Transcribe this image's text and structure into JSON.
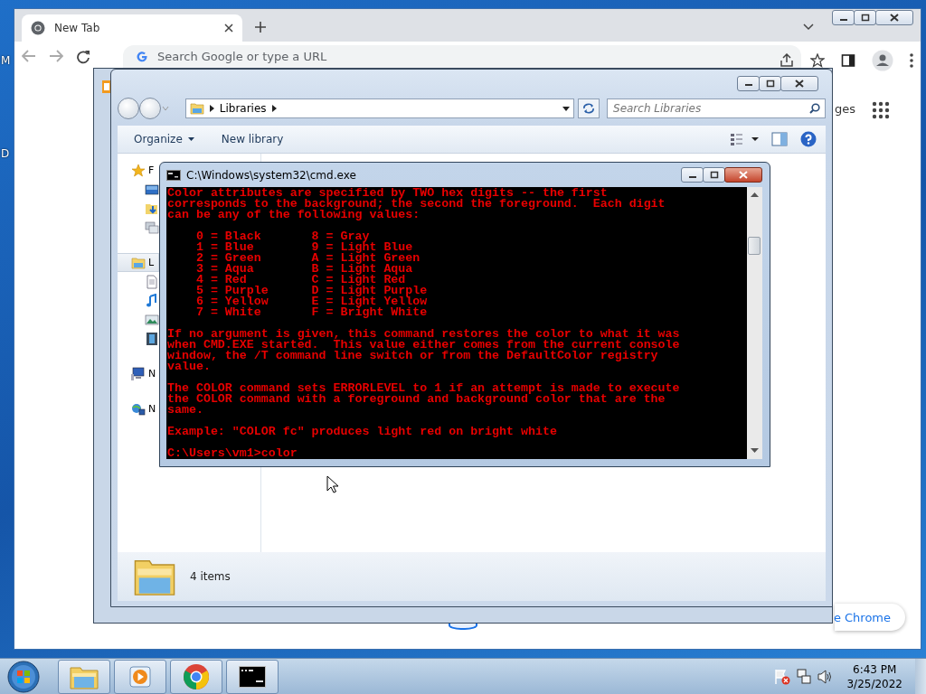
{
  "desktop": {
    "edge_labels": [
      "M",
      "D"
    ]
  },
  "browser": {
    "tabs": [
      {
        "title": "New Tab",
        "selected": true
      }
    ],
    "omnibox": {
      "placeholder": "Search Google or type a URL"
    },
    "shortcut_fragment": "ges",
    "customize_fragment": "e Chrome"
  },
  "explorer": {
    "address": [
      "Libraries"
    ],
    "search": {
      "placeholder": "Search Libraries"
    },
    "toolbar": [
      "Organize",
      "New library"
    ],
    "nav_items": [
      {
        "label": "F",
        "kind": "star",
        "selected": false,
        "children": [
          {
            "kind": "desktop"
          },
          {
            "kind": "downloads"
          },
          {
            "kind": "places"
          }
        ]
      },
      {
        "label": "L",
        "kind": "library",
        "selected": true,
        "children": [
          {
            "kind": "document"
          },
          {
            "kind": "music"
          },
          {
            "kind": "pictures"
          },
          {
            "kind": "video"
          }
        ]
      },
      {
        "label": "N",
        "kind": "computer",
        "selected": false
      },
      {
        "label": "N",
        "kind": "network",
        "selected": false
      }
    ],
    "status": "4 items"
  },
  "console": {
    "title": "C:\\Windows\\system32\\cmd.exe",
    "blocks": [
      [
        "Color attributes are specified by TWO hex digits -- the first",
        "corresponds to the background; the second the foreground.  Each digit",
        "can be any of the following values:"
      ],
      [
        "    0 = Black       8 = Gray",
        "    1 = Blue        9 = Light Blue",
        "    2 = Green       A = Light Green",
        "    3 = Aqua        B = Light Aqua",
        "    4 = Red         C = Light Red",
        "    5 = Purple      D = Light Purple",
        "    6 = Yellow      E = Light Yellow",
        "    7 = White       F = Bright White"
      ],
      [
        "If no argument is given, this command restores the color to what it was",
        "when CMD.EXE started.  This value either comes from the current console",
        "window, the /T command line switch or from the DefaultColor registry",
        "value."
      ],
      [
        "The COLOR command sets ERRORLEVEL to 1 if an attempt is made to execute",
        "the COLOR command with a foreground and background color that are the",
        "same."
      ],
      [
        "Example: \"COLOR fc\" produces light red on bright white"
      ],
      [
        "C:\\Users\\vm1>color"
      ]
    ]
  },
  "taskbar": {
    "buttons": [
      {
        "kind": "explorer"
      },
      {
        "kind": "media"
      },
      {
        "kind": "chrome"
      },
      {
        "kind": "console"
      }
    ],
    "clock": {
      "time": "6:43 PM",
      "date": "3/25/2022"
    }
  }
}
